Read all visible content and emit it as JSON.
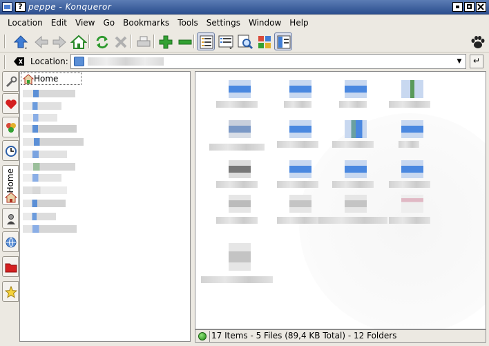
{
  "window": {
    "title": "peppe - Konqueror",
    "help_glyph": "?"
  },
  "menu": [
    "Location",
    "Edit",
    "View",
    "Go",
    "Bookmarks",
    "Tools",
    "Settings",
    "Window",
    "Help"
  ],
  "toolbar": {
    "icons": [
      "up-icon",
      "back-icon",
      "forward-icon",
      "home-icon",
      "reload-icon",
      "stop-icon",
      "print-icon",
      "zoom-in-icon",
      "zoom-out-icon",
      "icon-view-icon",
      "detail-view-icon",
      "find-icon",
      "view-mode-icon",
      "sidebar-toggle-icon"
    ]
  },
  "location": {
    "label": "Location:",
    "value": ""
  },
  "sidebar": {
    "tabs": [
      "bookmarks",
      "history-colors",
      "history",
      "home",
      "network",
      "services",
      "root-folder",
      "favorites"
    ],
    "active_tab_label": "Home",
    "tree_root": "Home"
  },
  "status": {
    "text": "17 Items - 5 Files (89,4 KB Total) - 12 Folders"
  },
  "colors": {
    "titlebar": "#2c4f8f",
    "accent": "#4a7ed4",
    "status_led": "#1f8a15"
  }
}
